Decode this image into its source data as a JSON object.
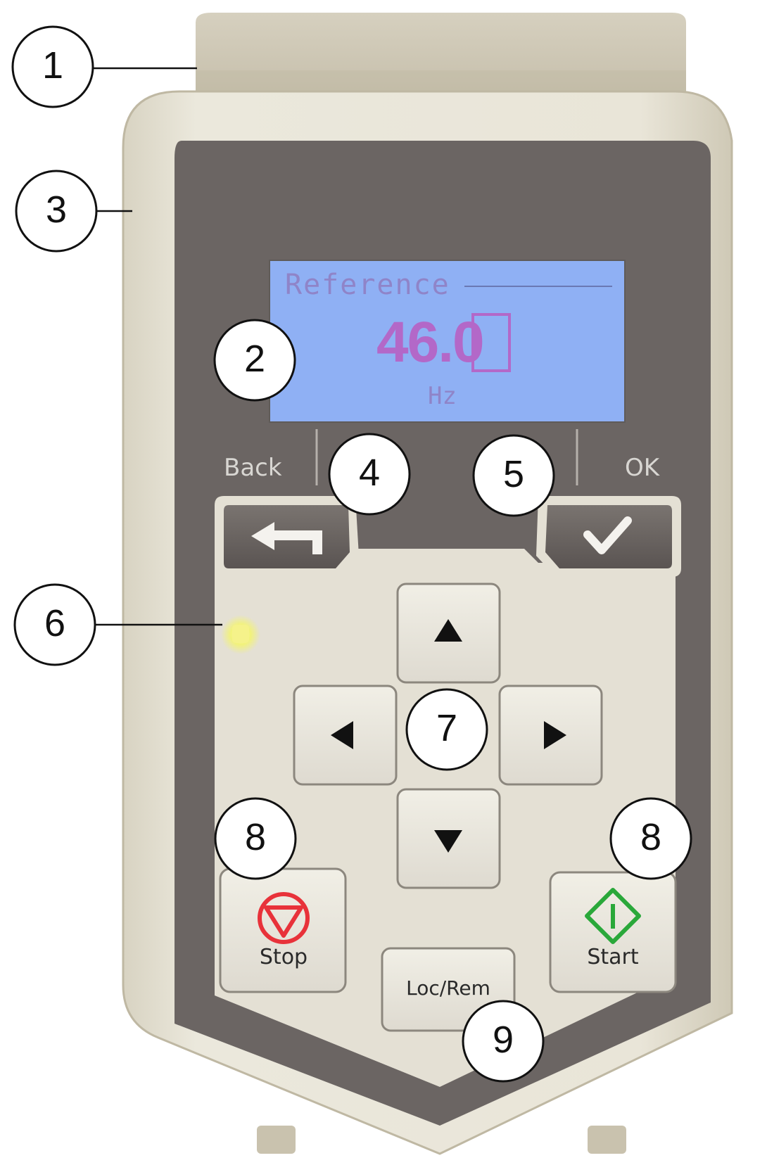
{
  "display": {
    "title": "Reference",
    "value_main": "46.",
    "value_cursor": "0",
    "unit": "Hz"
  },
  "softkeys": {
    "back_label": "Back",
    "ok_label": "OK"
  },
  "buttons": {
    "stop_label": "Stop",
    "start_label": "Start",
    "locrem_label": "Loc/Rem"
  },
  "callouts": {
    "c1": "1",
    "c2": "2",
    "c3": "3",
    "c4": "4",
    "c5": "5",
    "c6": "6",
    "c7": "7",
    "c8_left": "8",
    "c8_right": "8",
    "c9": "9"
  },
  "colors": {
    "shell": "#e6e2d3",
    "panel": "#6a6462",
    "lcd": "#8fb0f4",
    "lcd_text": "#b368c8",
    "stop_red": "#e8323a",
    "start_green": "#2aa83a",
    "status_led": "#f2f27a"
  },
  "icons": {
    "back": "return-arrow-icon",
    "ok": "checkmark-icon",
    "up": "arrow-up-icon",
    "down": "arrow-down-icon",
    "left": "arrow-left-icon",
    "right": "arrow-right-icon",
    "stop": "stop-icon",
    "start": "start-icon"
  }
}
